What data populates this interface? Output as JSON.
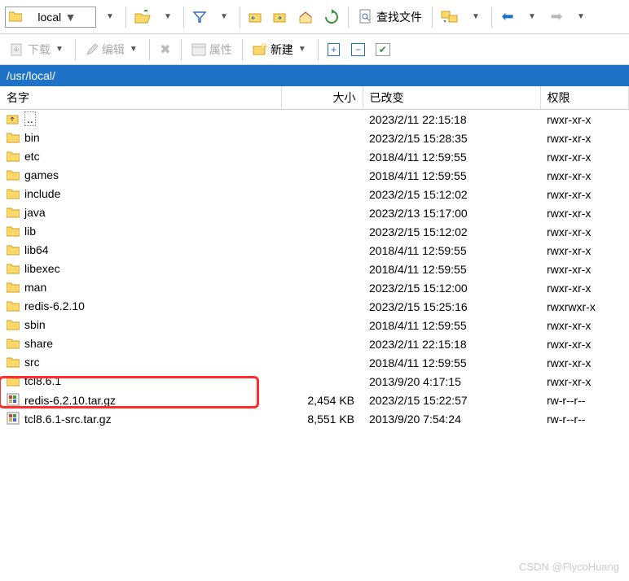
{
  "toolbar": {
    "location": "local",
    "find_label": "查找文件",
    "download_label": "下载",
    "edit_label": "编辑",
    "props_label": "属性",
    "new_label": "新建"
  },
  "path": "/usr/local/",
  "columns": {
    "name": "名字",
    "size": "大小",
    "changed": "已改变",
    "perm": "权限"
  },
  "rows": [
    {
      "icon": "up",
      "name": "..",
      "size": "",
      "changed": "2023/2/11 22:15:18",
      "perm": "rwxr-xr-x"
    },
    {
      "icon": "folder",
      "name": "bin",
      "size": "",
      "changed": "2023/2/15 15:28:35",
      "perm": "rwxr-xr-x"
    },
    {
      "icon": "folder",
      "name": "etc",
      "size": "",
      "changed": "2018/4/11 12:59:55",
      "perm": "rwxr-xr-x"
    },
    {
      "icon": "folder",
      "name": "games",
      "size": "",
      "changed": "2018/4/11 12:59:55",
      "perm": "rwxr-xr-x"
    },
    {
      "icon": "folder",
      "name": "include",
      "size": "",
      "changed": "2023/2/15 15:12:02",
      "perm": "rwxr-xr-x"
    },
    {
      "icon": "folder",
      "name": "java",
      "size": "",
      "changed": "2023/2/13 15:17:00",
      "perm": "rwxr-xr-x"
    },
    {
      "icon": "folder",
      "name": "lib",
      "size": "",
      "changed": "2023/2/15 15:12:02",
      "perm": "rwxr-xr-x"
    },
    {
      "icon": "folder",
      "name": "lib64",
      "size": "",
      "changed": "2018/4/11 12:59:55",
      "perm": "rwxr-xr-x"
    },
    {
      "icon": "folder",
      "name": "libexec",
      "size": "",
      "changed": "2018/4/11 12:59:55",
      "perm": "rwxr-xr-x"
    },
    {
      "icon": "folder",
      "name": "man",
      "size": "",
      "changed": "2023/2/15 15:12:00",
      "perm": "rwxr-xr-x"
    },
    {
      "icon": "folder",
      "name": "redis-6.2.10",
      "size": "",
      "changed": "2023/2/15 15:25:16",
      "perm": "rwxrwxr-x"
    },
    {
      "icon": "folder",
      "name": "sbin",
      "size": "",
      "changed": "2018/4/11 12:59:55",
      "perm": "rwxr-xr-x"
    },
    {
      "icon": "folder",
      "name": "share",
      "size": "",
      "changed": "2023/2/11 22:15:18",
      "perm": "rwxr-xr-x"
    },
    {
      "icon": "folder",
      "name": "src",
      "size": "",
      "changed": "2018/4/11 12:59:55",
      "perm": "rwxr-xr-x"
    },
    {
      "icon": "folder",
      "name": "tcl8.6.1",
      "size": "",
      "changed": "2013/9/20 4:17:15",
      "perm": "rwxr-xr-x"
    },
    {
      "icon": "archive",
      "name": "redis-6.2.10.tar.gz",
      "size": "2,454 KB",
      "changed": "2023/2/15 15:22:57",
      "perm": "rw-r--r--",
      "highlight": true
    },
    {
      "icon": "archive",
      "name": "tcl8.6.1-src.tar.gz",
      "size": "8,551 KB",
      "changed": "2013/9/20 7:54:24",
      "perm": "rw-r--r--"
    }
  ],
  "watermark": "CSDN @FlycoHuang"
}
